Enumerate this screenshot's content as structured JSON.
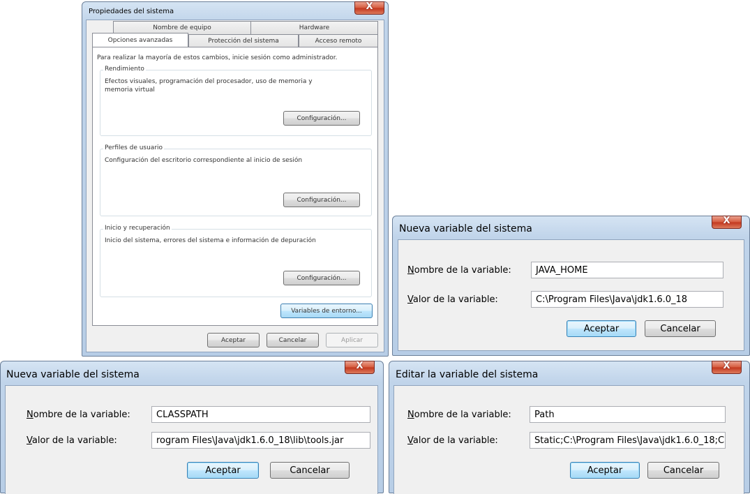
{
  "system_properties": {
    "title": "Propiedades del sistema",
    "close_glyph": "X",
    "tabs_row_back": [
      "Nombre de equipo",
      "Hardware"
    ],
    "tabs_row_front": [
      "Opciones avanzadas",
      "Protección del sistema",
      "Acceso remoto"
    ],
    "admin_note": "Para realizar la mayoría de estos cambios, inicie sesión como administrador.",
    "groups": [
      {
        "label": "Rendimiento",
        "text": "Efectos visuales, programación del procesador, uso de memoria y memoria virtual",
        "button": "Configuración..."
      },
      {
        "label": "Perfiles de usuario",
        "text": "Configuración del escritorio correspondiente al inicio de sesión",
        "button": "Configuración..."
      },
      {
        "label": "Inicio y recuperación",
        "text": "Inicio del sistema, errores del sistema e información de depuración",
        "button": "Configuración..."
      }
    ],
    "env_button": "Variables de entorno...",
    "ok": "Aceptar",
    "cancel": "Cancelar",
    "apply": "Aplicar"
  },
  "dialog_java_home": {
    "title": "Nueva variable del sistema",
    "name_label": "Nombre de la variable:",
    "value_label": "Valor de la variable:",
    "name_value": "JAVA_HOME",
    "value_value": "C:\\Program Files\\Java\\jdk1.6.0_18",
    "ok": "Aceptar",
    "cancel": "Cancelar"
  },
  "dialog_classpath": {
    "title": "Nueva variable del sistema",
    "name_label": "Nombre de la variable:",
    "value_label": "Valor de la variable:",
    "name_value": "CLASSPATH",
    "value_value": "rogram Files\\Java\\jdk1.6.0_18\\lib\\tools.jar",
    "ok": "Aceptar",
    "cancel": "Cancelar"
  },
  "dialog_path": {
    "title": "Editar la variable del sistema",
    "name_label": "Nombre de la variable:",
    "value_label": "Valor de la variable:",
    "name_value": "Path",
    "value_value": "Static;C:\\Program Files\\Java\\jdk1.6.0_18;C",
    "ok": "Aceptar",
    "cancel": "Cancelar"
  },
  "colors": {
    "frame": "#c0d4ea",
    "close_button": "#c2361d",
    "default_button": "#bee6fd"
  }
}
